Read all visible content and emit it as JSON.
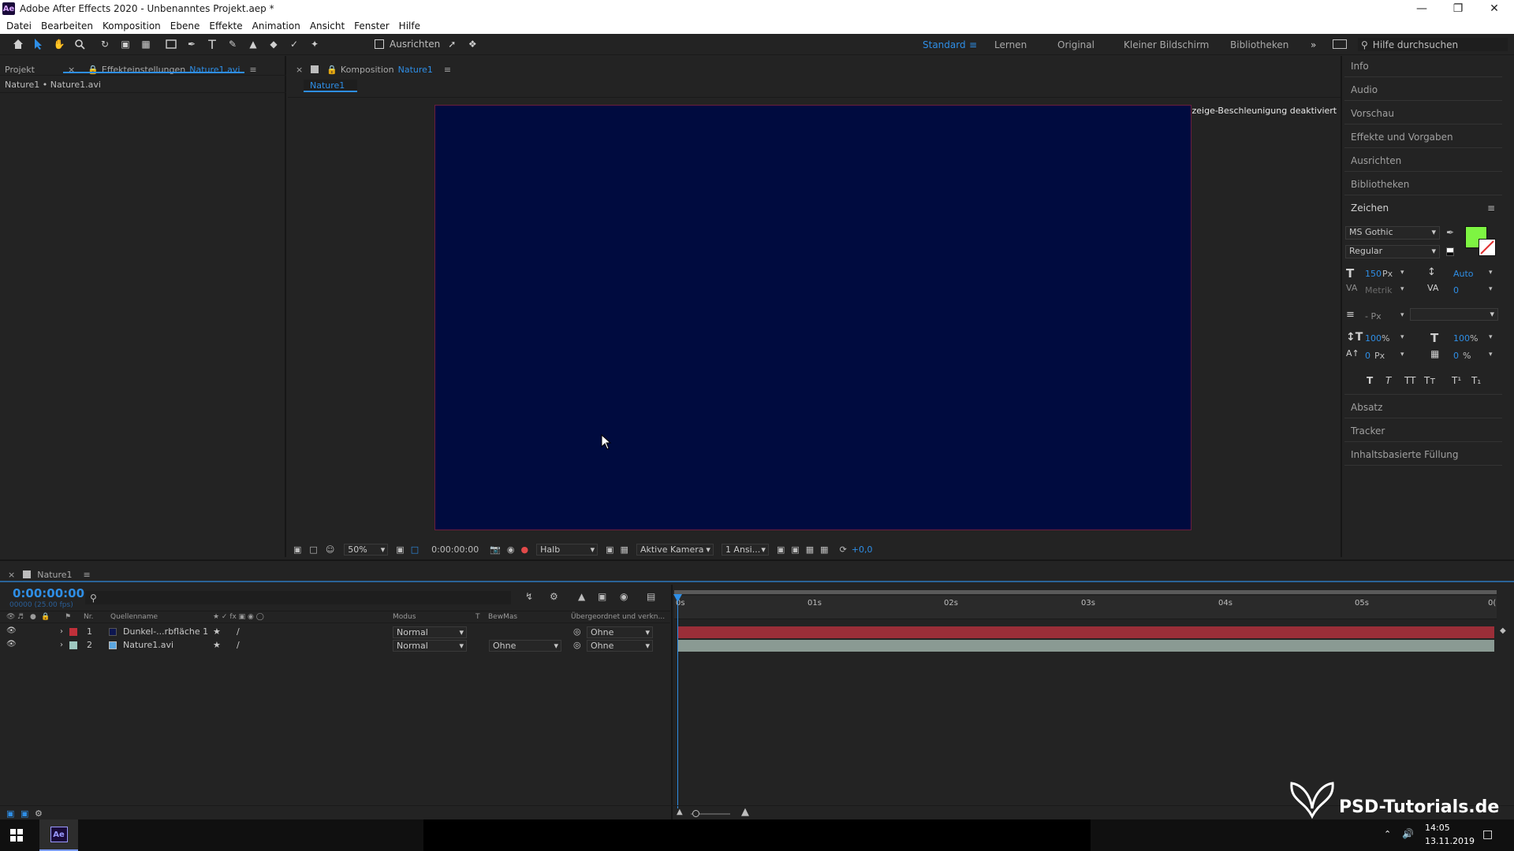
{
  "window": {
    "title": "Adobe After Effects 2020 - Unbenanntes Projekt.aep *",
    "logo_text": "Ae"
  },
  "menu": [
    "Datei",
    "Bearbeiten",
    "Komposition",
    "Ebene",
    "Effekte",
    "Animation",
    "Ansicht",
    "Fenster",
    "Hilfe"
  ],
  "toolbar": {
    "align_label": "Ausrichten",
    "workspaces": [
      "Standard",
      "Lernen",
      "Original",
      "Kleiner Bildschirm",
      "Bibliotheken"
    ],
    "active_workspace": "Standard",
    "search_placeholder": "Hilfe durchsuchen"
  },
  "left_panel": {
    "tab_project": "Projekt",
    "tab_effects": "Effekteinstellungen",
    "tab_effects_file": "Nature1.avi",
    "breadcrumb": "Nature1 • Nature1.avi"
  },
  "comp_panel": {
    "tab_prefix": "Komposition",
    "tab_name": "Nature1",
    "subtab": "Nature1",
    "overlay_message": "Anzeige-Beschleunigung deaktiviert",
    "canvas_color": "#000b3f"
  },
  "viewer_bar": {
    "zoom": "50%",
    "timecode": "0:00:00:00",
    "resolution": "Halb",
    "camera": "Aktive Kamera",
    "views": "1 Ansi...",
    "exposure": "+0,0"
  },
  "right_panel": {
    "items_top": [
      "Info",
      "Audio",
      "Vorschau",
      "Effekte und Vorgaben",
      "Ausrichten",
      "Bibliotheken"
    ],
    "character_title": "Zeichen",
    "font": "MS Gothic",
    "style": "Regular",
    "font_size": "150",
    "font_size_unit": "Px",
    "leading": "Auto",
    "kerning": "Metrik",
    "tracking": "0",
    "stroke_unit": "- Px",
    "vscale": "100",
    "vscale_unit": "%",
    "hscale": "100",
    "hscale_unit": "%",
    "baseline": "0",
    "baseline_unit": "Px",
    "tsume": "0",
    "tsume_unit": "%",
    "fill_color": "#7ef542",
    "type_buttons": [
      "T",
      "T",
      "TT",
      "Tт",
      "T¹",
      "T₁"
    ],
    "items_bottom": [
      "Absatz",
      "Tracker",
      "Inhaltsbasierte Füllung"
    ]
  },
  "timeline": {
    "tab_name": "Nature1",
    "timecode": "0:00:00:00",
    "frame_info": "00000 (25.00 fps)",
    "columns": {
      "nr": "Nr.",
      "source": "Quellenname",
      "mode": "Modus",
      "t": "T",
      "trkmat": "BewMas",
      "parent": "Übergeordnet und verkn..."
    },
    "ruler": [
      "0s",
      "01s",
      "02s",
      "03s",
      "04s",
      "05s",
      "0("
    ],
    "layers": [
      {
        "nr": "1",
        "name": "Dunkel-...rbfläche 1",
        "mode": "Normal",
        "trkmat": "",
        "parent": "Ohne",
        "label_color": "#c0303a",
        "bar_color": "#9b2e38"
      },
      {
        "nr": "2",
        "name": "Nature1.avi",
        "mode": "Normal",
        "trkmat": "Ohne",
        "parent": "Ohne",
        "label_color": "#9ec8c0",
        "bar_color": "#8a9a93"
      }
    ]
  },
  "watermark": "PSD-Tutorials.de",
  "taskbar": {
    "time": "14:05",
    "date": "13.11.2019",
    "app": "Ae"
  }
}
